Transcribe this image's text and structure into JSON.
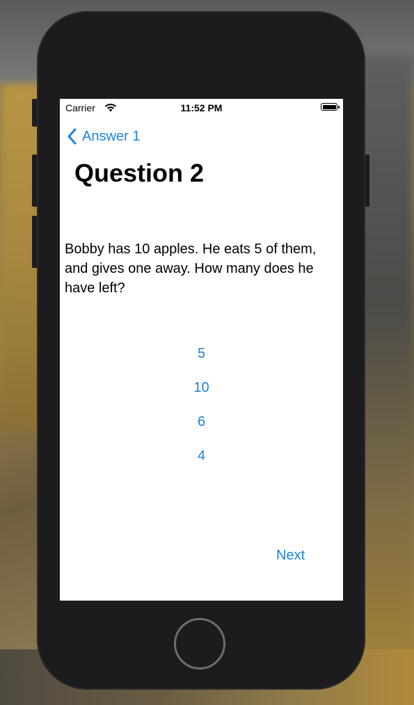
{
  "status_bar": {
    "carrier": "Carrier",
    "time": "11:52 PM"
  },
  "nav": {
    "back_label": "Answer 1"
  },
  "question": {
    "title": "Question 2",
    "text": "Bobby has 10 apples. He eats 5 of them, and gives one away. How many does he have left?"
  },
  "answers": [
    "5",
    "10",
    "6",
    "4"
  ],
  "footer": {
    "next_label": "Next"
  },
  "colors": {
    "accent": "#1a82e2",
    "phone_body": "#1c1c1e",
    "screen": "#ffffff"
  },
  "icons": {
    "back": "chevron-left-icon",
    "wifi": "wifi-icon",
    "battery": "battery-icon"
  }
}
